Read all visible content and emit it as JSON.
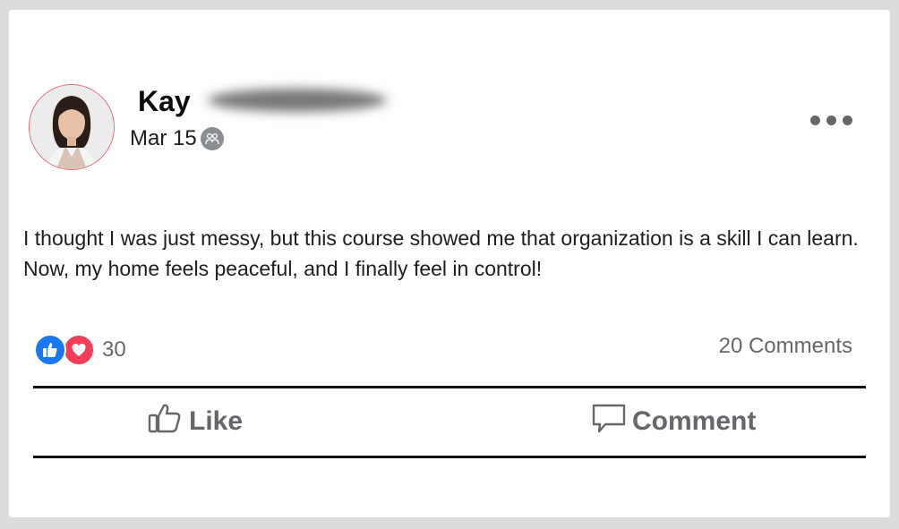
{
  "post": {
    "author_name": "Kay",
    "date": "Mar 15",
    "privacy_icon": "friends-icon",
    "text": "I thought I was just messy, but this course showed me that organization is a skill I can learn. Now, my home feels peaceful, and I finally feel in control!"
  },
  "reactions": {
    "icons": [
      "like-icon",
      "love-icon"
    ],
    "count": "30",
    "comments_label": "20 Comments"
  },
  "actions": {
    "like_label": "Like",
    "comment_label": "Comment"
  },
  "colors": {
    "like_blue": "#1877f2",
    "love_red": "#f33e58",
    "muted_gray": "#65676b"
  }
}
